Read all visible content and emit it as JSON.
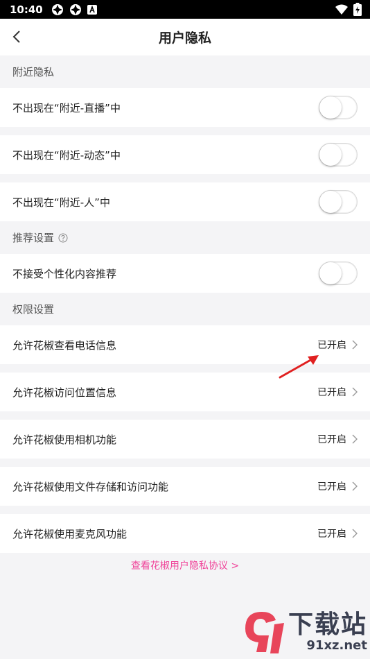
{
  "status_bar": {
    "time": "10:40"
  },
  "nav": {
    "title": "用户隐私"
  },
  "sections": {
    "nearby": {
      "header": "附近隐私"
    },
    "recommend": {
      "header": "推荐设置"
    },
    "permission": {
      "header": "权限设置"
    }
  },
  "nearby_rows": [
    {
      "label": "不出现在“附近-直播”中",
      "enabled": false
    },
    {
      "label": "不出现在“附近-动态”中",
      "enabled": false
    },
    {
      "label": "不出现在“附近-人”中",
      "enabled": false
    }
  ],
  "recommend_rows": [
    {
      "label": "不接受个性化内容推荐",
      "enabled": false
    }
  ],
  "permission_rows": [
    {
      "label": "允许花椒查看电话信息",
      "value": "已开启"
    },
    {
      "label": "允许花椒访问位置信息",
      "value": "已开启"
    },
    {
      "label": "允许花椒使用相机功能",
      "value": "已开启"
    },
    {
      "label": "允许花椒使用文件存储和访问功能",
      "value": "已开启"
    },
    {
      "label": "允许花椒使用麦克风功能",
      "value": "已开启"
    }
  ],
  "footer": {
    "link": "查看花椒用户隐私协议 >"
  },
  "watermark": {
    "big": "下载站",
    "small": "91xz.net"
  },
  "colors": {
    "accent_pink": "#f0449a",
    "annotation_red": "#e02020"
  }
}
